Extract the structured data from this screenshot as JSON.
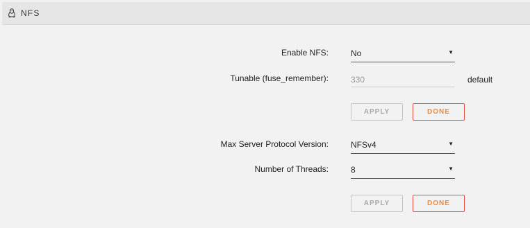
{
  "header": {
    "title": "NFS",
    "icon": "linux-penguin-icon"
  },
  "colors": {
    "done_border": "#e24b3b",
    "done_text": "#ee8a3c",
    "apply_border": "#c4c4c4"
  },
  "enable_nfs": {
    "label": "Enable NFS:",
    "value": "No"
  },
  "tunable": {
    "label": "Tunable (fuse_remember):",
    "placeholder": "330",
    "hint": "default"
  },
  "buttons_1": {
    "apply": "APPLY",
    "done": "DONE"
  },
  "protocol": {
    "label": "Max Server Protocol Version:",
    "value": "NFSv4"
  },
  "threads": {
    "label": "Number of Threads:",
    "value": "8"
  },
  "buttons_2": {
    "apply": "APPLY",
    "done": "DONE"
  }
}
